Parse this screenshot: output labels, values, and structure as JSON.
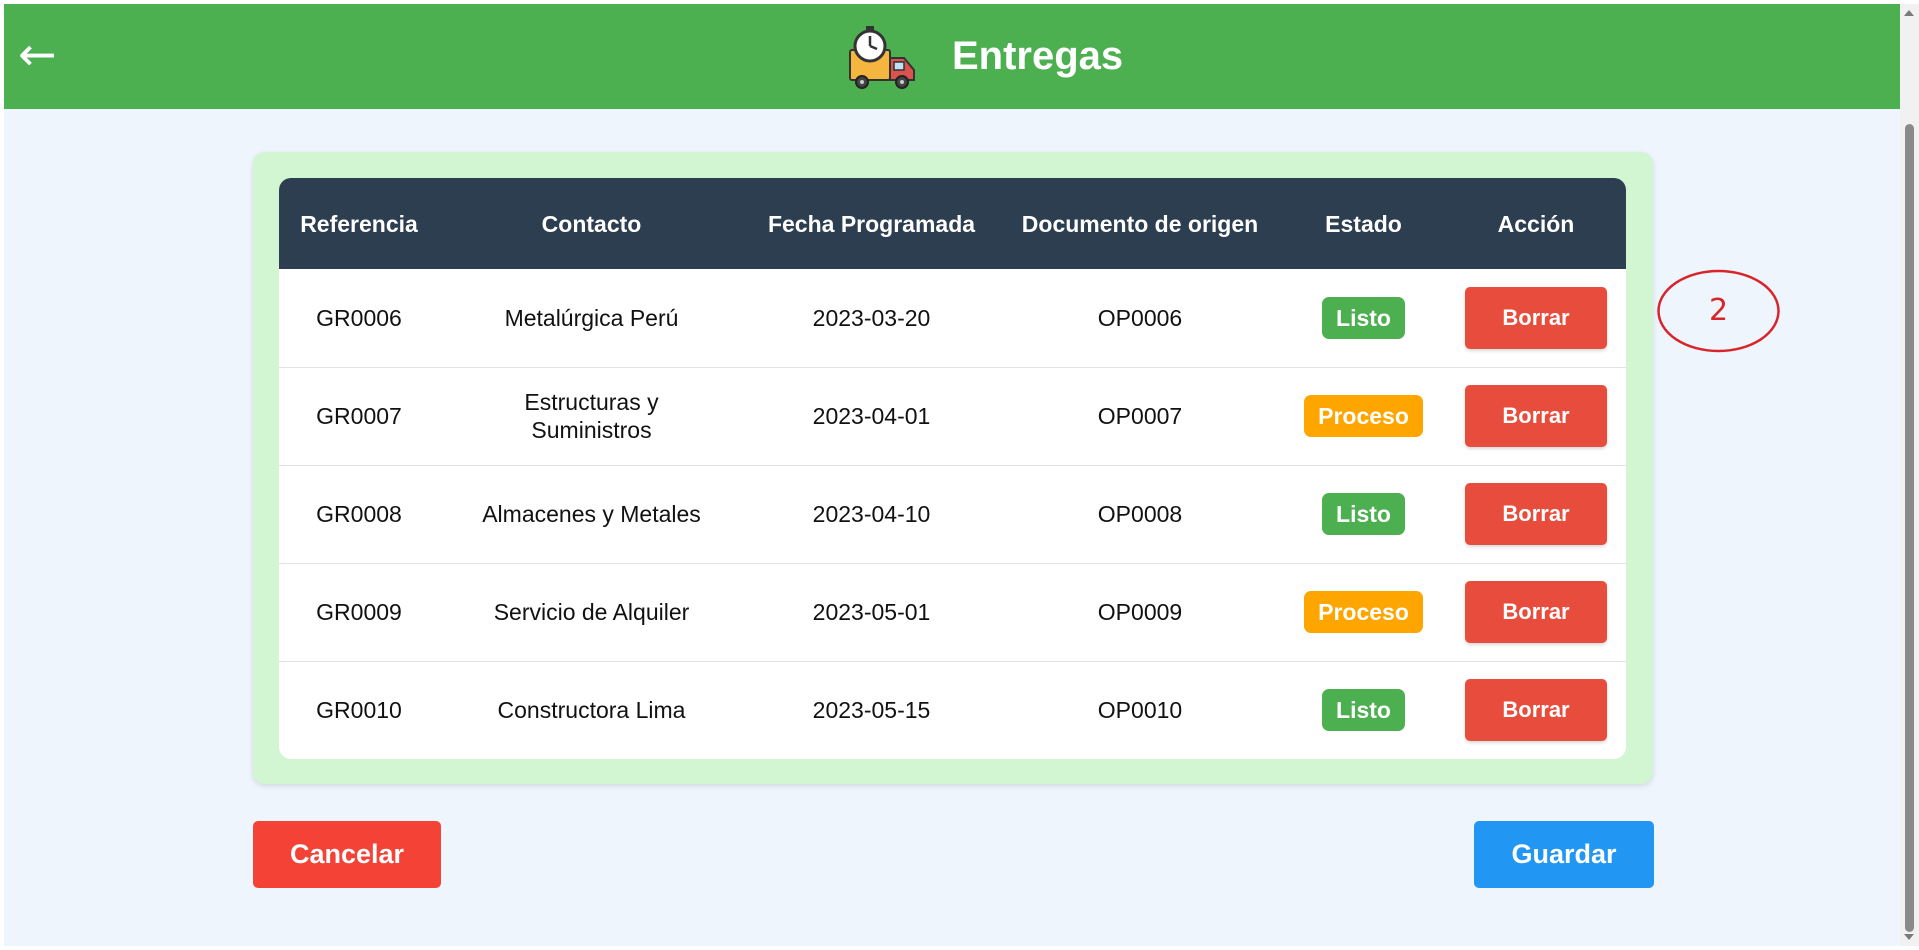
{
  "header": {
    "back_icon": "arrow-left-icon",
    "back_glyph": "←",
    "logo_icon": "delivery-truck-stopwatch-icon",
    "title": "Entregas"
  },
  "table": {
    "columns": [
      "Referencia",
      "Contacto",
      "Fecha Programada",
      "Documento de origen",
      "Estado",
      "Acción"
    ],
    "rows": [
      {
        "referencia": "GR0006",
        "contacto": "Metalúrgica Perú",
        "fecha": "2023-03-20",
        "documento": "OP0006",
        "estado": "Listo",
        "accion": "Borrar"
      },
      {
        "referencia": "GR0007",
        "contacto": "Estructuras y Suministros",
        "fecha": "2023-04-01",
        "documento": "OP0007",
        "estado": "Proceso",
        "accion": "Borrar"
      },
      {
        "referencia": "GR0008",
        "contacto": "Almacenes y Metales",
        "fecha": "2023-04-10",
        "documento": "OP0008",
        "estado": "Listo",
        "accion": "Borrar"
      },
      {
        "referencia": "GR0009",
        "contacto": "Servicio de Alquiler",
        "fecha": "2023-05-01",
        "documento": "OP0009",
        "estado": "Proceso",
        "accion": "Borrar"
      },
      {
        "referencia": "GR0010",
        "contacto": "Constructora Lima",
        "fecha": "2023-05-15",
        "documento": "OP0010",
        "estado": "Listo",
        "accion": "Borrar"
      }
    ]
  },
  "actions": {
    "cancel_label": "Cancelar",
    "save_label": "Guardar"
  },
  "annotation": {
    "label": "2"
  },
  "colors": {
    "header_bg": "#4caf50",
    "table_header_bg": "#2c3e50",
    "status_listo": "#4caf50",
    "status_proceso": "#ffa500",
    "delete_button": "#e74c3c",
    "cancel_button": "#f44336",
    "save_button": "#2196f3",
    "panel_bg": "#d2f5d2",
    "annotation": "#d9242b"
  }
}
